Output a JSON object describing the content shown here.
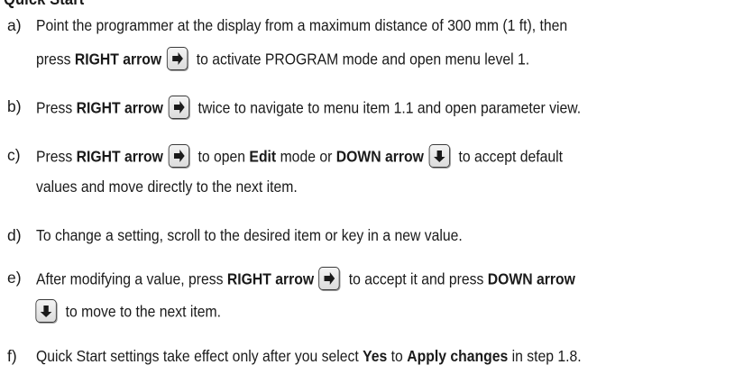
{
  "heading": "Quick Start",
  "steps": [
    {
      "marker": "a)",
      "line1_a": "Point the programmer at the display from a maximum distance of 300 mm (1 ft), then",
      "line2_a": "press ",
      "line2_b": "RIGHT arrow",
      "line2_c": " to activate PROGRAM mode and open menu level 1."
    },
    {
      "marker": "b)",
      "line1_a": "Press ",
      "line1_b": "RIGHT arrow",
      "line1_c": " twice to navigate to menu item 1.1 and open parameter view."
    },
    {
      "marker": "c)",
      "line1_a": "Press ",
      "line1_b": "RIGHT arrow",
      "line1_c": " to open ",
      "line1_d": "Edit",
      "line1_e": " mode or ",
      "line1_f": "DOWN arrow",
      "line1_g": " to accept default",
      "line2_a": "values and move directly to the next item."
    },
    {
      "marker": "d)",
      "line1_a": "To change a setting, scroll to the desired item or key in a new value."
    },
    {
      "marker": "e)",
      "line1_a": "After modifying a value, press ",
      "line1_b": "RIGHT arrow",
      "line1_c": " to accept it and press ",
      "line1_d": "DOWN arrow",
      "line2_a": " to move to the next item."
    },
    {
      "marker": "f)",
      "line1_a": "Quick Start settings take effect only after you select ",
      "line1_b": "Yes",
      "line1_c": " to ",
      "line1_d": "Apply changes",
      "line1_e": " in step 1.8."
    }
  ],
  "icons": {
    "right": "right-arrow-key-icon",
    "down": "down-arrow-key-icon"
  }
}
